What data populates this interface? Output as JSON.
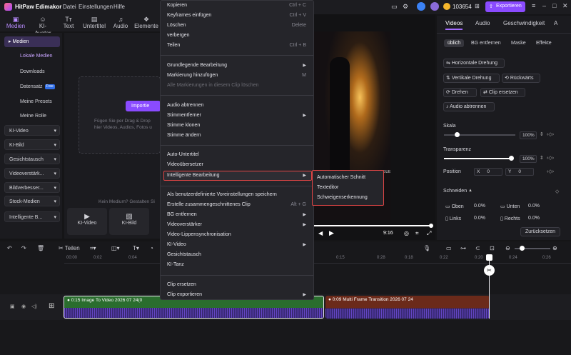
{
  "app": {
    "title": "HitPaw Edimakor",
    "coins": "103654",
    "export_label": "Exportieren"
  },
  "titlemenu": [
    "Datei",
    "Einstellungen",
    "Hilfe"
  ],
  "toolbar": [
    {
      "icon": "media-icon",
      "label": "Medien"
    },
    {
      "icon": "ai-avatar-icon",
      "label": "KI-Avatar"
    },
    {
      "icon": "text-icon",
      "label": "Text"
    },
    {
      "icon": "subtitle-icon",
      "label": "Untertitel"
    },
    {
      "icon": "audio-icon",
      "label": "Audio"
    },
    {
      "icon": "elements-icon",
      "label": "Elemente"
    }
  ],
  "sidebar": {
    "media": "Medien",
    "sub": [
      "Lokale Medien",
      "Downloads",
      "Datensatz",
      "Meine Presets",
      "Meine Rolle"
    ],
    "free_badge": "Free",
    "groups": [
      "KI-Video",
      "KI-Bild",
      "Gesichtstausch",
      "Videoverstärk...",
      "Bildverbesser...",
      "Stock-Medien",
      "Intelligente B..."
    ]
  },
  "media": {
    "import_label": "Importie",
    "drop_hint_1": "Fügen Sie per Drag & Drop",
    "drop_hint_2": "hier Videos, Audios, Fotos u",
    "no_media": "Kein Medium? Gestalten Si",
    "cards": [
      "KI-Video",
      "KI-Bild"
    ]
  },
  "preview": {
    "time": "9:16",
    "league": "LEAGUE"
  },
  "right_panel": {
    "tabs": [
      "Videos",
      "Audio",
      "Geschwindigkeit",
      "A"
    ],
    "subtabs": [
      "üblich",
      "BG entfernen",
      "Maske",
      "Effekte"
    ],
    "buttons": [
      "Horizontale Drehung",
      "Vertikale Drehung",
      "Rückwärts",
      "Drehen",
      "Clip ersetzen",
      "Audio abtrennen"
    ],
    "scale_label": "Skala",
    "scale_value": "100%",
    "transparency_label": "Transparenz",
    "transparency_value": "100%",
    "position_label": "Position",
    "pos_x_label": "X",
    "pos_x": "0",
    "pos_y_label": "Y",
    "pos_y": "0",
    "crop_label": "Schneiden",
    "crop": [
      {
        "label": "Oben",
        "value": "0.0%"
      },
      {
        "label": "Unten",
        "value": "0.0%"
      },
      {
        "label": "Links",
        "value": "0.0%"
      },
      {
        "label": "Rechts",
        "value": "0.0%"
      }
    ],
    "reset_label": "Zurücksetzen"
  },
  "timeline": {
    "split_label": "Teilen",
    "ticks": [
      "00:00",
      "0:02",
      "0:04",
      "0:15",
      "0:18",
      "0:20",
      "0:22",
      "0:24",
      "0:26",
      "0:28"
    ],
    "clip1": "0:15 Image To Video 2026 07 24(0",
    "clip2": "0:09 Multi Frame Transition 2026 07 24"
  },
  "context_menu": [
    {
      "label": "Kopieren",
      "shortcut": "Ctrl + C"
    },
    {
      "label": "Keyframes einfügen",
      "shortcut": "Ctrl + V"
    },
    {
      "label": "Löschen",
      "shortcut": "Delete"
    },
    {
      "label": "verbergen",
      "shortcut": ""
    },
    {
      "label": "Teilen",
      "shortcut": "Ctrl + B"
    },
    {
      "label": "Grundlegende Bearbeitung",
      "shortcut": "",
      "submenu": true
    },
    {
      "label": "Markierung hinzufügen",
      "shortcut": "M"
    },
    {
      "label": "Alle Markierungen in diesem Clip löschen",
      "shortcut": "",
      "disabled": true
    },
    {
      "label": "Audio abtrennen",
      "shortcut": ""
    },
    {
      "label": "Stimmentferner",
      "shortcut": "",
      "submenu": true
    },
    {
      "label": "Stimme klonen",
      "shortcut": ""
    },
    {
      "label": "Stimme ändern",
      "shortcut": ""
    },
    {
      "label": "Auto-Untertitel",
      "shortcut": ""
    },
    {
      "label": "Videoübersetzer",
      "shortcut": ""
    },
    {
      "label": "Intelligente Bearbeitung",
      "shortcut": "",
      "submenu": true,
      "highlighted": true
    },
    {
      "label": "Als benutzerdefinierte Voreinstellungen speichern",
      "shortcut": ""
    },
    {
      "label": "Erstelle zusammengeschnittenes Clip",
      "shortcut": "Alt + G"
    },
    {
      "label": "BG entfernen",
      "shortcut": "",
      "submenu": true
    },
    {
      "label": "Videoverstärker",
      "shortcut": "",
      "submenu": true
    },
    {
      "label": "Video-Lippensynchronisation",
      "shortcut": ""
    },
    {
      "label": "KI-Video",
      "shortcut": "",
      "submenu": true
    },
    {
      "label": "Gesichtstausch",
      "shortcut": ""
    },
    {
      "label": "KI-Tanz",
      "shortcut": ""
    },
    {
      "label": "Clip ersetzen",
      "shortcut": ""
    },
    {
      "label": "Clip exportieren",
      "shortcut": "",
      "submenu": true
    }
  ],
  "submenu": [
    "Automatischer Schnitt",
    "Texteditor",
    "Schweigenserkennung"
  ],
  "colors": {
    "accent": "#8a4bff",
    "highlight_border": "#e04545",
    "background": "#151517"
  }
}
